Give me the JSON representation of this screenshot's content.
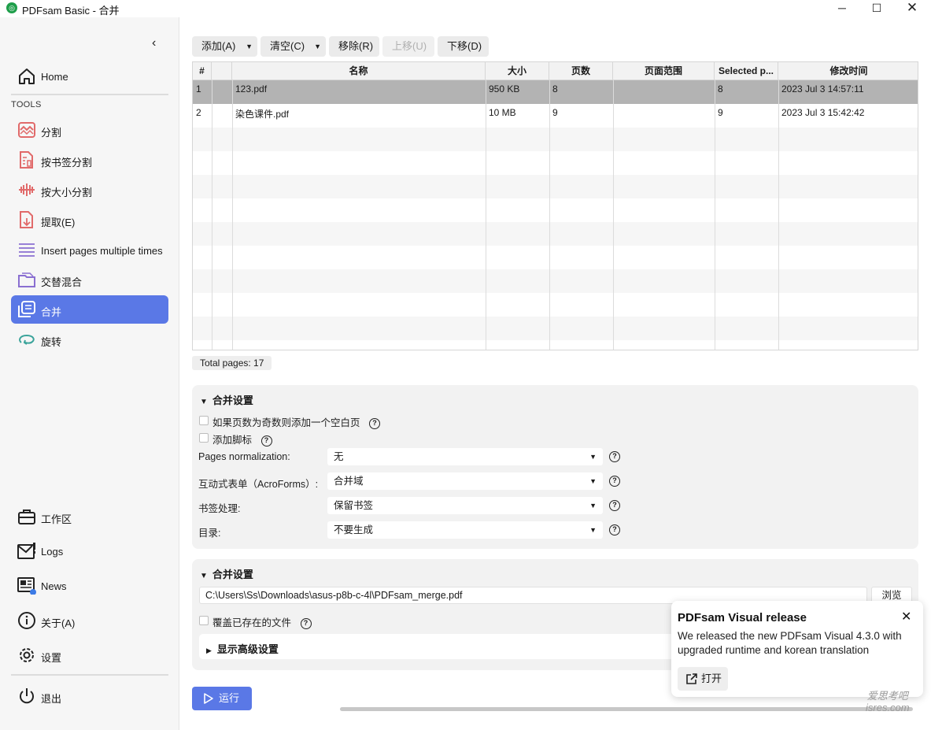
{
  "window": {
    "title": "PDFsam Basic - 合并",
    "minimize": "─",
    "maximize": "☐",
    "close": "✕"
  },
  "sidebar": {
    "collapse": "‹",
    "home": "Home",
    "tools_label": "TOOLS",
    "tools": [
      {
        "label": "分割",
        "icon": "split-icon"
      },
      {
        "label": "按书签分割",
        "icon": "bookmark-split-icon"
      },
      {
        "label": "按大小分割",
        "icon": "size-split-icon"
      },
      {
        "label": "提取(E)",
        "icon": "extract-icon"
      },
      {
        "label": "Insert pages multiple times",
        "icon": "insert-pages-icon"
      },
      {
        "label": "交替混合",
        "icon": "alternate-mix-icon"
      },
      {
        "label": "合并",
        "icon": "merge-icon"
      },
      {
        "label": "旋转",
        "icon": "rotate-icon"
      }
    ],
    "bottom": [
      {
        "label": "工作区",
        "icon": "workspace-icon"
      },
      {
        "label": "Logs",
        "icon": "logs-icon"
      },
      {
        "label": "News",
        "icon": "news-icon"
      },
      {
        "label": "关于(A)",
        "icon": "info-icon"
      },
      {
        "label": "设置",
        "icon": "gear-icon"
      }
    ],
    "exit": "退出"
  },
  "toolbar": {
    "add": "添加(A)",
    "clear": "清空(C)",
    "remove": "移除(R)",
    "move_up": "上移(U)",
    "move_down": "下移(D)"
  },
  "table": {
    "headers": [
      "#",
      "",
      "名称",
      "大小",
      "页数",
      "页面范围",
      "Selected p...",
      "修改时间"
    ],
    "rows": [
      {
        "index": "1",
        "name": "123.pdf",
        "size": "950 KB",
        "pages": "8",
        "range": "",
        "selected": "8",
        "modified": "2023 Jul 3 14:57:11"
      },
      {
        "index": "2",
        "name": "染色课件.pdf",
        "size": "10 MB",
        "pages": "9",
        "range": "",
        "selected": "9",
        "modified": "2023 Jul 3 15:42:42"
      }
    ]
  },
  "total_pages": "Total pages: 17",
  "merge_settings": {
    "title": "合并设置",
    "blank_page": "如果页数为奇数则添加一个空白页",
    "footer": "添加脚标",
    "normalization_label": "Pages normalization:",
    "normalization_value": "无",
    "acroforms_label": "互动式表单（AcroForms）:",
    "acroforms_value": "合并域",
    "bookmarks_label": "书签处理:",
    "bookmarks_value": "保留书签",
    "toc_label": "目录:",
    "toc_value": "不要生成"
  },
  "output_settings": {
    "title": "合并设置",
    "path": "C:\\Users\\Ss\\Downloads\\asus-p8b-c-4l\\PDFsam_merge.pdf",
    "browse": "浏览",
    "overwrite": "覆盖已存在的文件",
    "advanced": "显示高级设置"
  },
  "run": "运行",
  "help_glyph": "?",
  "notification": {
    "title": "PDFsam Visual release",
    "message": "We released the new PDFsam Visual 4.3.0 with upgraded runtime and korean translation",
    "open": "打开",
    "close": "✕"
  },
  "watermark": {
    "line1": "爱思考吧",
    "line2": "isres.com"
  },
  "colors": {
    "accent": "#5a78e6",
    "selected_row": "#b3b3b3",
    "tool_icon": "#e16a6a"
  }
}
